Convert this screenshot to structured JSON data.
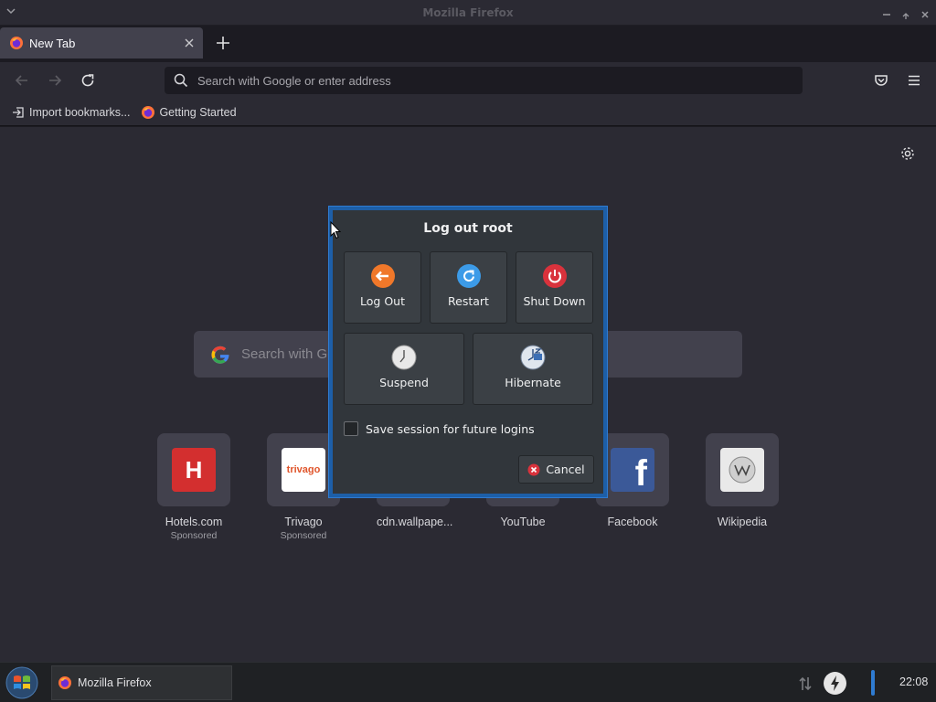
{
  "window": {
    "title": "Mozilla Firefox"
  },
  "tabs": [
    {
      "label": "New Tab"
    }
  ],
  "navbar": {
    "url_placeholder": "Search with Google or enter address"
  },
  "bookmarks": [
    {
      "label": "Import bookmarks...",
      "icon": "import-icon"
    },
    {
      "label": "Getting Started",
      "icon": "firefox-icon"
    }
  ],
  "newtab": {
    "search_placeholder": "Search with Google or enter address",
    "tiles": [
      {
        "name": "Hotels.com",
        "sponsor": "Sponsored",
        "logo_text": "H",
        "logo_bg": "#d32f2f",
        "logo_fg": "#ffffff"
      },
      {
        "name": "Trivago",
        "sponsor": "Sponsored",
        "logo_text": "trivago",
        "logo_bg": "#ffffff",
        "logo_fg": "#e0552b"
      },
      {
        "name": "cdn.wallpape...",
        "sponsor": "",
        "logo_text": "",
        "logo_bg": "#5a5a62",
        "logo_fg": "#ffffff"
      },
      {
        "name": "YouTube",
        "sponsor": "",
        "logo_text": "",
        "logo_bg": "#e02020",
        "logo_fg": "#ffffff"
      },
      {
        "name": "Facebook",
        "sponsor": "",
        "logo_text": "f",
        "logo_bg": "#3b5998",
        "logo_fg": "#ffffff"
      },
      {
        "name": "Wikipedia",
        "sponsor": "",
        "logo_text": "W",
        "logo_bg": "#e9e9e9",
        "logo_fg": "#555555"
      }
    ]
  },
  "dialog": {
    "title": "Log out root",
    "buttons_row1": [
      {
        "label": "Log Out",
        "icon": "logout-icon",
        "color": "#f0782a"
      },
      {
        "label": "Restart",
        "icon": "restart-icon",
        "color": "#3c9be8"
      },
      {
        "label": "Shut Down",
        "icon": "power-icon",
        "color": "#d9323c"
      }
    ],
    "buttons_row2": [
      {
        "label": "Suspend",
        "icon": "clock-icon"
      },
      {
        "label": "Hibernate",
        "icon": "hibernate-icon"
      }
    ],
    "save_session_label": "Save session for future logins",
    "cancel_label": "Cancel"
  },
  "taskbar": {
    "task_label": "Mozilla Firefox",
    "clock": "22:08"
  },
  "colors": {
    "accent": "#1d5fa8",
    "dialog_bg": "#31363b"
  }
}
